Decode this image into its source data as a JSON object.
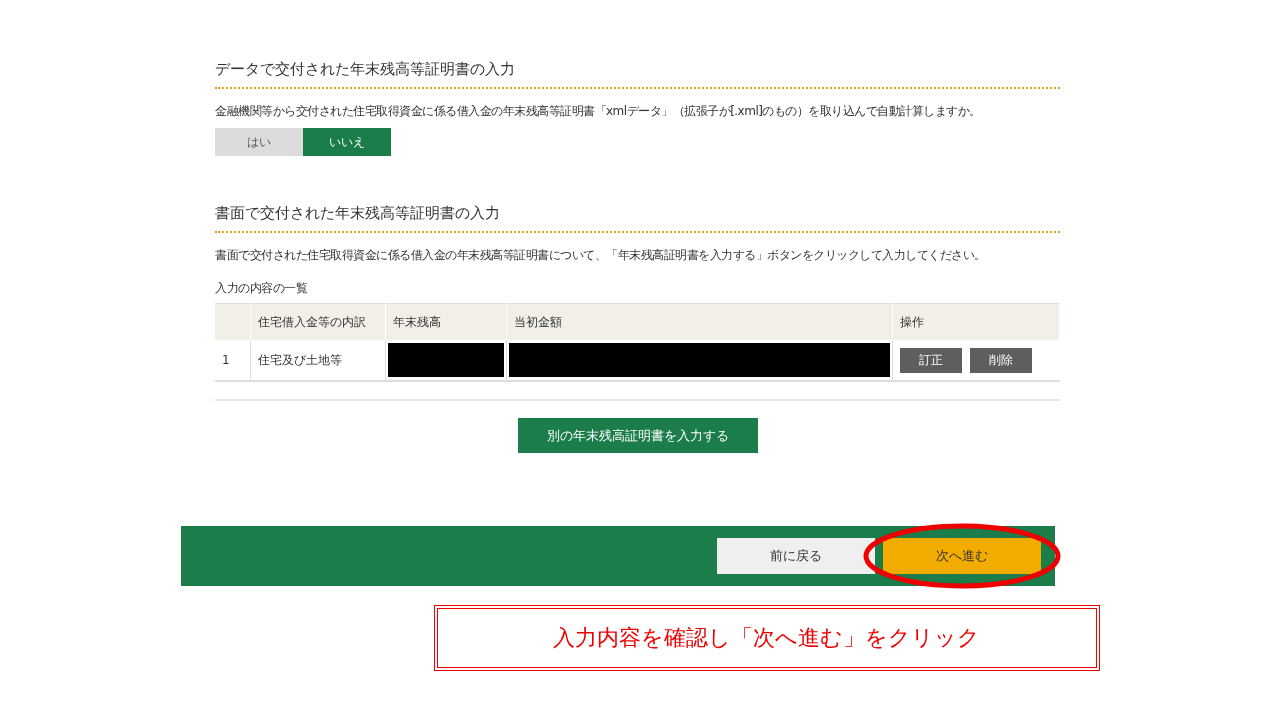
{
  "data_section": {
    "title": "データで交付された年末残高等証明書の入力",
    "description": "金融機関等から交付された住宅取得資金に係る借入金の年末残高等証明書「xmlデータ」（拡張子が[.xml]のもの）を取り込んで自動計算しますか。",
    "options": [
      {
        "label": "はい",
        "selected": false
      },
      {
        "label": "いいえ",
        "selected": true
      }
    ]
  },
  "paper_section": {
    "title": "書面で交付された年末残高等証明書の入力",
    "description": "書面で交付された住宅取得資金に係る借入金の年末残高等証明書について、「年末残高証明書を入力する」ボタンをクリックして入力してください。",
    "list_label": "入力の内容の一覧",
    "table": {
      "columns": [
        "住宅借入金等の内訳",
        "年末残高",
        "当初金額",
        "操作"
      ],
      "rows": [
        {
          "number": "1",
          "breakdown": "住宅及び土地等",
          "balance": {
            "redacted": true
          },
          "initial_amount": {
            "redacted": true
          },
          "actions": [
            "訂正",
            "削除"
          ]
        }
      ]
    },
    "add_button": "別の年末残高証明書を入力する"
  },
  "footer": {
    "buttons": [
      {
        "label": "前に戻る",
        "kind": "back",
        "highlighted": false
      },
      {
        "label": "次へ進む",
        "kind": "next",
        "highlighted": true
      }
    ]
  },
  "callout": "入力内容を確認し「次へ進む」をクリック"
}
